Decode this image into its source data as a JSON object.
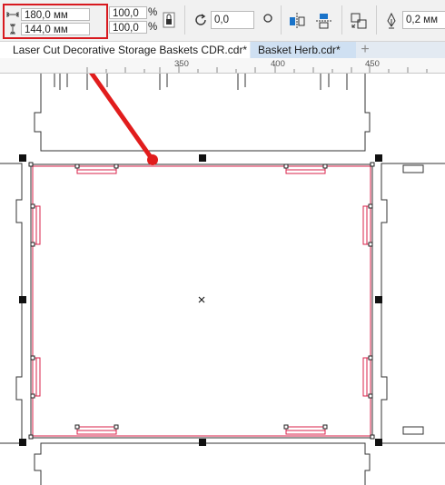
{
  "toolbar": {
    "width_value": "180,0 мм",
    "height_value": "144,0 мм",
    "scale_x": "100,0",
    "scale_y": "100,0",
    "percent_sign": "%",
    "rotation_value": "0,0",
    "outline_value": "0,2 мм",
    "highlight_color": "#d8191f"
  },
  "tabs": [
    {
      "label": "Laser Cut Decorative Storage Baskets CDR.cdr*",
      "active": true
    },
    {
      "label": "Basket Herb.cdr*",
      "active": false
    }
  ],
  "ruler": {
    "ticks": [
      "350",
      "400",
      "450"
    ]
  },
  "icons": [
    "width-icon",
    "height-icon",
    "lock-ratio-icon",
    "rotate-icon",
    "circle-icon",
    "mirror-horizontal-icon",
    "mirror-vertical-icon",
    "transform-icon",
    "pen-outline-icon",
    "add-tab-icon",
    "center-marker-icon"
  ],
  "annotation": {
    "arrow_color": "#e11d1d"
  }
}
